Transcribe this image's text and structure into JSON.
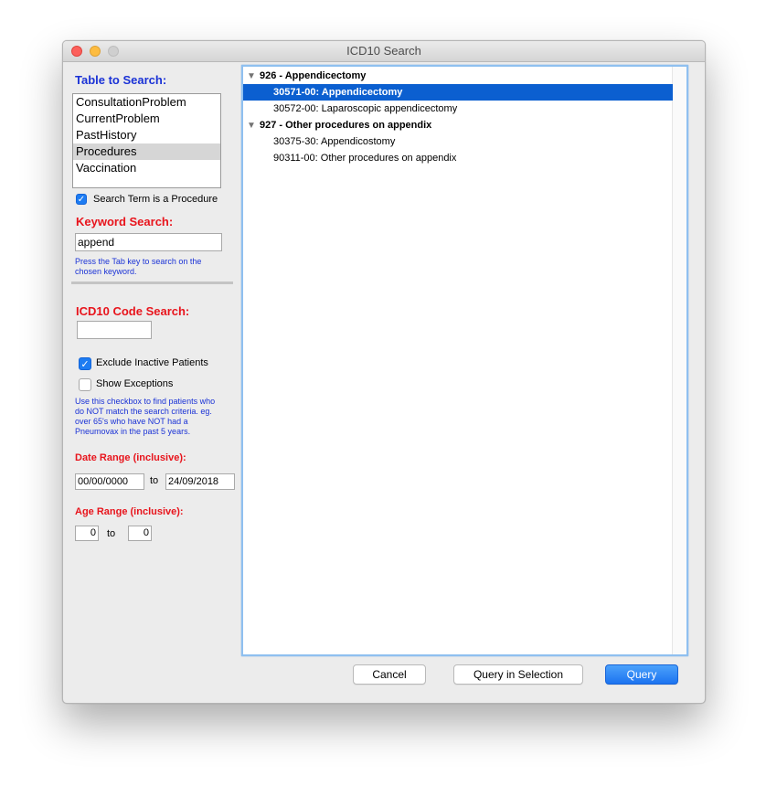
{
  "window": {
    "title": "ICD10 Search"
  },
  "left": {
    "table_label": "Table to Search:",
    "tables": [
      {
        "label": "ConsultationProblem"
      },
      {
        "label": "CurrentProblem"
      },
      {
        "label": "PastHistory"
      },
      {
        "label": "Procedures"
      },
      {
        "label": "Vaccination"
      }
    ],
    "selected_table": "Procedures",
    "procedure_cb": {
      "label": "Search Term is a Procedure",
      "checked": true
    },
    "keyword_label": "Keyword Search:",
    "keyword_value": "append",
    "keyword_hint_1": "Press the Tab key to search on the",
    "keyword_hint_2": "chosen keyword.",
    "icd_label": "ICD10 Code Search:",
    "icd_value": "",
    "exclude_cb": {
      "label": "Exclude Inactive Patients",
      "checked": true
    },
    "exceptions_cb": {
      "label": "Show Exceptions",
      "checked": false
    },
    "exceptions_hint": [
      "Use this checkbox to find patients who",
      "do NOT match the search criteria. eg.",
      "over 65's who have NOT had a",
      "Pneumovax in the past 5 years."
    ],
    "date_label": "Date Range (inclusive):",
    "date_from": "00/00/0000",
    "date_to_word": "to",
    "date_to": "24/09/2018",
    "age_label": "Age Range (inclusive):",
    "age_from": "0",
    "age_to_word": "to",
    "age_to": "0"
  },
  "tree": {
    "groups": [
      {
        "label": "926 - Appendicectomy",
        "items": [
          {
            "label": "30571-00: Appendicectomy",
            "selected": true
          },
          {
            "label": "30572-00: Laparoscopic appendicectomy",
            "selected": false
          }
        ]
      },
      {
        "label": "927 - Other procedures on appendix",
        "items": [
          {
            "label": "30375-30: Appendicostomy",
            "selected": false
          },
          {
            "label": "90311-00: Other procedures on appendix",
            "selected": false
          }
        ]
      }
    ]
  },
  "buttons": {
    "cancel": "Cancel",
    "query_selection": "Query in Selection",
    "query": "Query"
  },
  "colors": {
    "accent": "#1d7cf2",
    "selection": "#0b5fd0",
    "label_blue": "#1a32d6",
    "label_red": "#e8141c"
  },
  "icons": {
    "checkmark": "check-icon",
    "disclosure": "disclosure-triangle-icon"
  }
}
